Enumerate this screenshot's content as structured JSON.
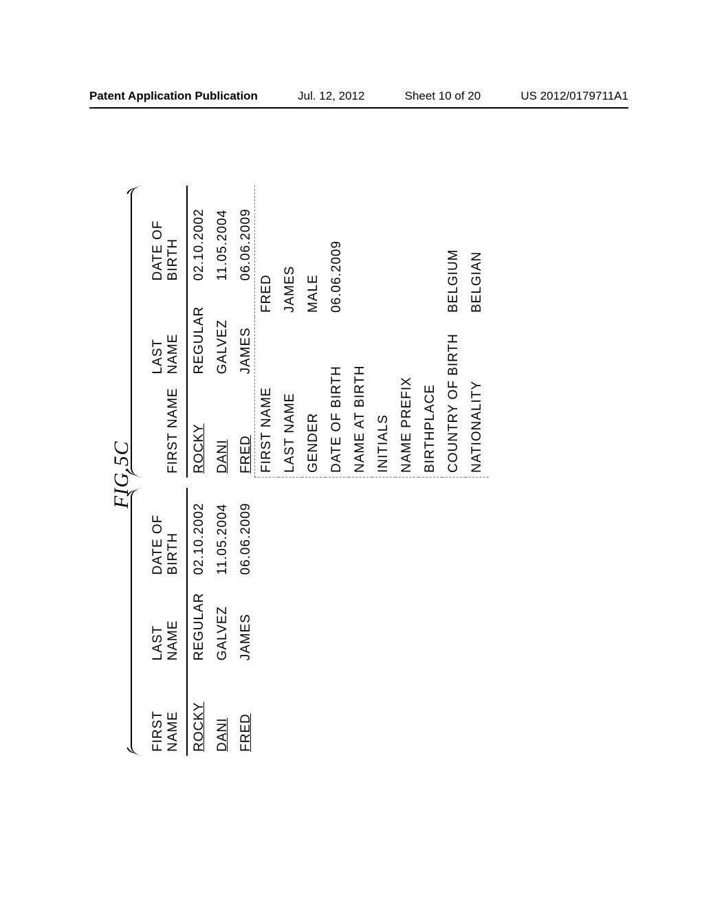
{
  "header": {
    "left": "Patent Application Publication",
    "center_date": "Jul. 12, 2012",
    "center_sheet": "Sheet 10 of 20",
    "right": "US 2012/0179711A1"
  },
  "figure_caption": "FIG.5C",
  "list": {
    "headers": {
      "first": "FIRST NAME",
      "last_l1": "LAST",
      "last_l2": "NAME",
      "dob_l1": "DATE OF",
      "dob_l2": "BIRTH"
    },
    "rows": [
      {
        "first": "ROCKY",
        "last": "REGULAR",
        "dob": "02.10.2002"
      },
      {
        "first": "DANI",
        "last": "GALVEZ",
        "dob": "11.05.2004"
      },
      {
        "first": "FRED",
        "last": "JAMES",
        "dob": "06.06.2009"
      }
    ]
  },
  "details": {
    "fields": [
      {
        "label": "FIRST NAME",
        "value": "FRED"
      },
      {
        "label": "LAST NAME",
        "value": "JAMES"
      },
      {
        "label": "GENDER",
        "value": "MALE"
      },
      {
        "label": "DATE OF BIRTH",
        "value": "06.06.2009"
      },
      {
        "label": "NAME AT BIRTH",
        "value": ""
      },
      {
        "label": "INITIALS",
        "value": ""
      },
      {
        "label": "NAME PREFIX",
        "value": ""
      },
      {
        "label": "BIRTHPLACE",
        "value": ""
      },
      {
        "label": "COUNTRY OF BIRTH",
        "value": "BELGIUM"
      },
      {
        "label": "NATIONALITY",
        "value": "BELGIAN"
      }
    ]
  }
}
